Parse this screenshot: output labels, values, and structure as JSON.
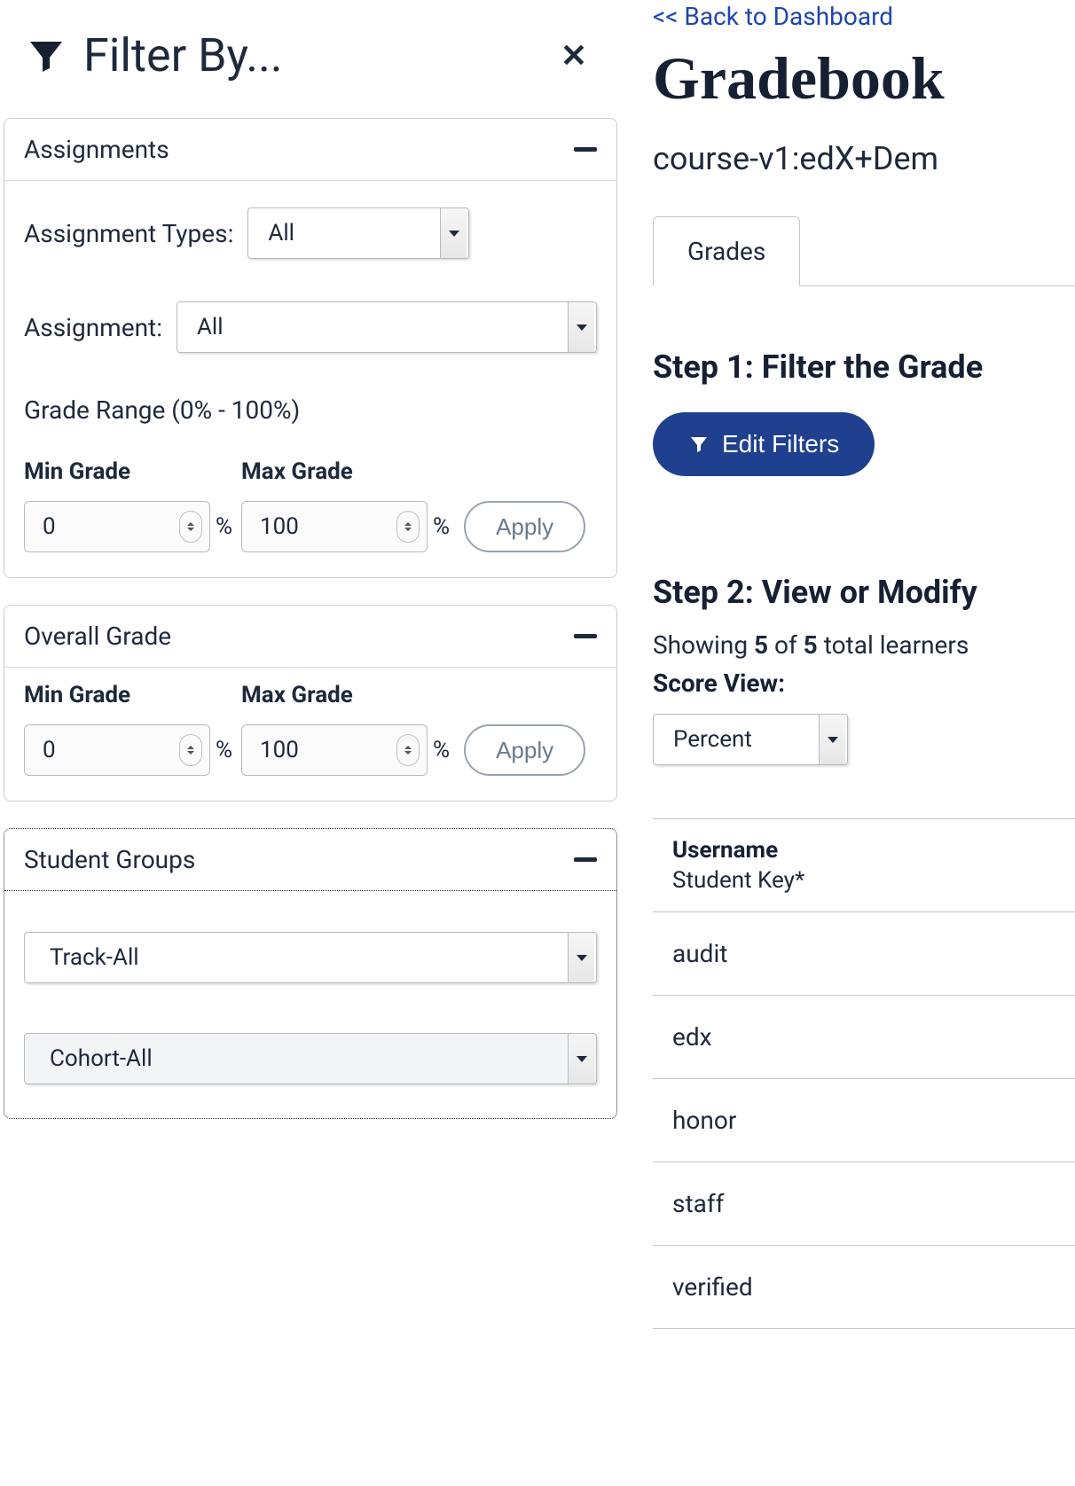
{
  "sidebar": {
    "title": "Filter By...",
    "panels": {
      "assignments": {
        "title": "Assignments",
        "assignment_types_label": "Assignment Types:",
        "assignment_types_value": "All",
        "assignment_label": "Assignment:",
        "assignment_value": "All",
        "grade_range_label": "Grade Range (0% - 100%)",
        "min_label": "Min Grade",
        "min_value": "0",
        "max_label": "Max Grade",
        "max_value": "100",
        "apply": "Apply"
      },
      "overall": {
        "title": "Overall Grade",
        "min_label": "Min Grade",
        "min_value": "0",
        "max_label": "Max Grade",
        "max_value": "100",
        "apply": "Apply"
      },
      "groups": {
        "title": "Student Groups",
        "track_value": "Track-All",
        "cohort_value": "Cohort-All"
      }
    }
  },
  "main": {
    "back_link": "<< Back to Dashboard",
    "page_title": "Gradebook",
    "course_id": "course-v1:edX+Dem",
    "tab_grades": "Grades",
    "step1_title": "Step 1: Filter the Grade",
    "edit_filters": "Edit Filters",
    "step2_title": "Step 2: View or Modify",
    "showing_prefix": "Showing ",
    "showing_count": "5",
    "showing_of": " of ",
    "showing_total": "5",
    "showing_suffix": " total learners",
    "score_view_label": "Score View:",
    "score_view_value": "Percent",
    "table": {
      "header_main": "Username",
      "header_sub": "Student Key*",
      "rows": [
        "audit",
        "edx",
        "honor",
        "staff",
        "verified"
      ]
    }
  },
  "labels": {
    "percent_sign": "%"
  }
}
